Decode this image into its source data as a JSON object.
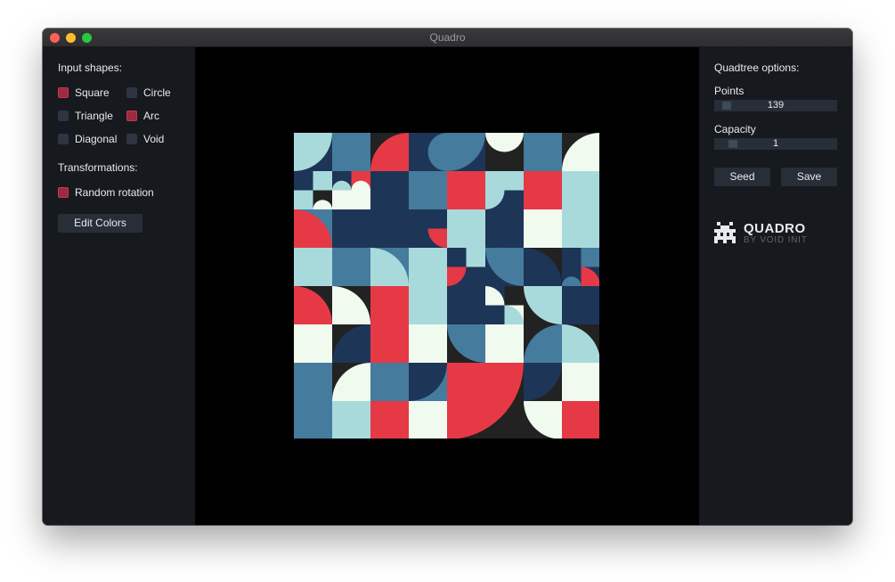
{
  "window": {
    "title": "Quadro"
  },
  "left": {
    "input_shapes_label": "Input shapes:",
    "shapes": [
      {
        "label": "Square",
        "checked": true
      },
      {
        "label": "Circle",
        "checked": false
      },
      {
        "label": "Triangle",
        "checked": false
      },
      {
        "label": "Arc",
        "checked": true
      },
      {
        "label": "Diagonal",
        "checked": false
      },
      {
        "label": "Void",
        "checked": false
      }
    ],
    "transformations_label": "Transformations:",
    "random_rotation": {
      "label": "Random rotation",
      "checked": true
    },
    "edit_colors_label": "Edit Colors"
  },
  "right": {
    "quadtree_label": "Quadtree options:",
    "points": {
      "label": "Points",
      "value": "139",
      "fraction": 0.05
    },
    "capacity": {
      "label": "Capacity",
      "value": "1",
      "fraction": 0.1
    },
    "seed_label": "Seed",
    "save_label": "Save",
    "logo": {
      "name": "QUADRO",
      "by": "BY VOID INIT"
    }
  },
  "palette": {
    "red": "#e63946",
    "mint": "#f1faee",
    "light_blue": "#a8dadc",
    "blue": "#457b9d",
    "navy": "#1d3557",
    "charcoal": "#222222",
    "checkbox_on": "#9b2b3f"
  }
}
